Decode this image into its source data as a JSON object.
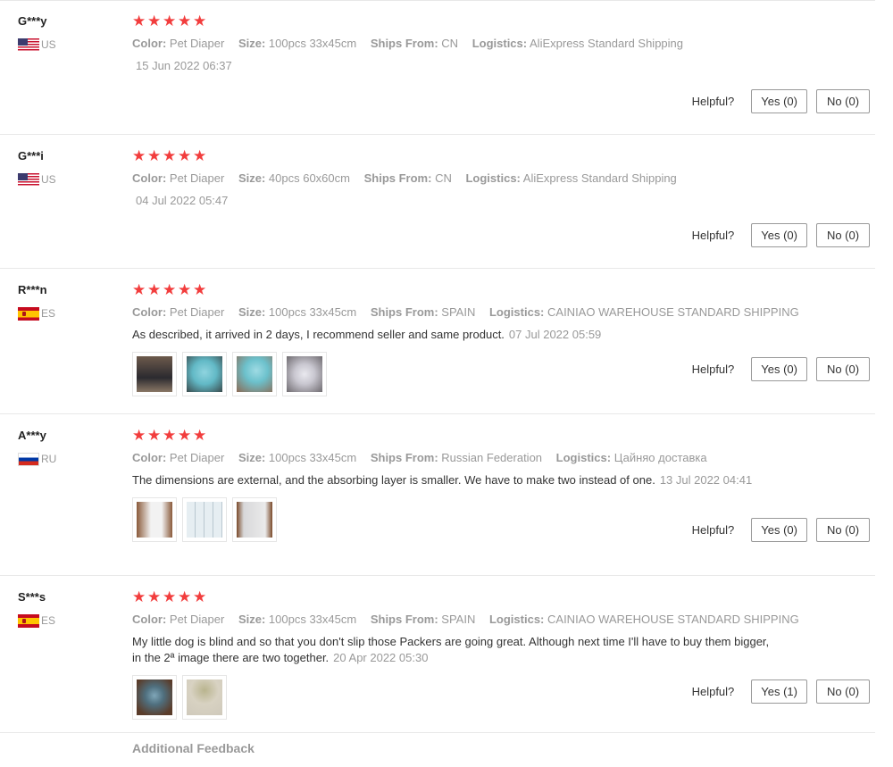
{
  "labels": {
    "color_key": "Color:",
    "size_key": "Size:",
    "ships_key": "Ships From:",
    "logistics_key": "Logistics:",
    "helpful": "Helpful?",
    "additional_feedback": "Additional Feedback"
  },
  "star_glyph": "★",
  "reviews": [
    {
      "user": "G***y",
      "country": "US",
      "rating": 5,
      "color": "Pet Diaper",
      "size": "100pcs 33x45cm",
      "ships_from": "CN",
      "logistics": "AliExpress Standard Shipping",
      "text": "",
      "date": "15 Jun 2022 06:37",
      "yes": "Yes (0)",
      "no": "No (0)",
      "images": []
    },
    {
      "user": "G***i",
      "country": "US",
      "rating": 5,
      "color": "Pet Diaper",
      "size": "40pcs 60x60cm",
      "ships_from": "CN",
      "logistics": "AliExpress Standard Shipping",
      "text": "",
      "date": "04 Jul 2022 05:47",
      "yes": "Yes (0)",
      "no": "No (0)",
      "images": []
    },
    {
      "user": "R***n",
      "country": "ES",
      "rating": 5,
      "color": "Pet Diaper",
      "size": "100pcs 33x45cm",
      "ships_from": "SPAIN",
      "logistics": "CAINIAO WAREHOUSE STANDARD SHIPPING",
      "text": "As described, it arrived in 2 days, I recommend seller and same product.",
      "date": "07 Jul 2022 05:59",
      "yes": "Yes (0)",
      "no": "No (0)",
      "images": [
        "package-photo",
        "pad-photo",
        "pad-photo",
        "bag-photo"
      ]
    },
    {
      "user": "A***y",
      "country": "RU",
      "rating": 5,
      "color": "Pet Diaper",
      "size": "100pcs 33x45cm",
      "ships_from": "Russian Federation",
      "logistics": "Цайняо доставка",
      "text": "The dimensions are external, and the absorbing layer is smaller. We have to make two instead of one.",
      "date": "13 Jul 2022 04:41",
      "yes": "Yes (0)",
      "no": "No (0)",
      "images": [
        "pad-photo",
        "pad-photo",
        "pad-photo"
      ]
    },
    {
      "user": "S***s",
      "country": "ES",
      "rating": 5,
      "color": "Pet Diaper",
      "size": "100pcs 33x45cm",
      "ships_from": "SPAIN",
      "logistics": "CAINIAO WAREHOUSE STANDARD SHIPPING",
      "text": "My little dog is blind and so that you don't slip those Packers are going great. Although next time I'll have to buy them bigger, in the 2ª image there are two together.",
      "date": "20 Apr 2022 05:30",
      "yes": "Yes (1)",
      "no": "No (0)",
      "images": [
        "dog-photo",
        "dog-photo"
      ]
    }
  ]
}
